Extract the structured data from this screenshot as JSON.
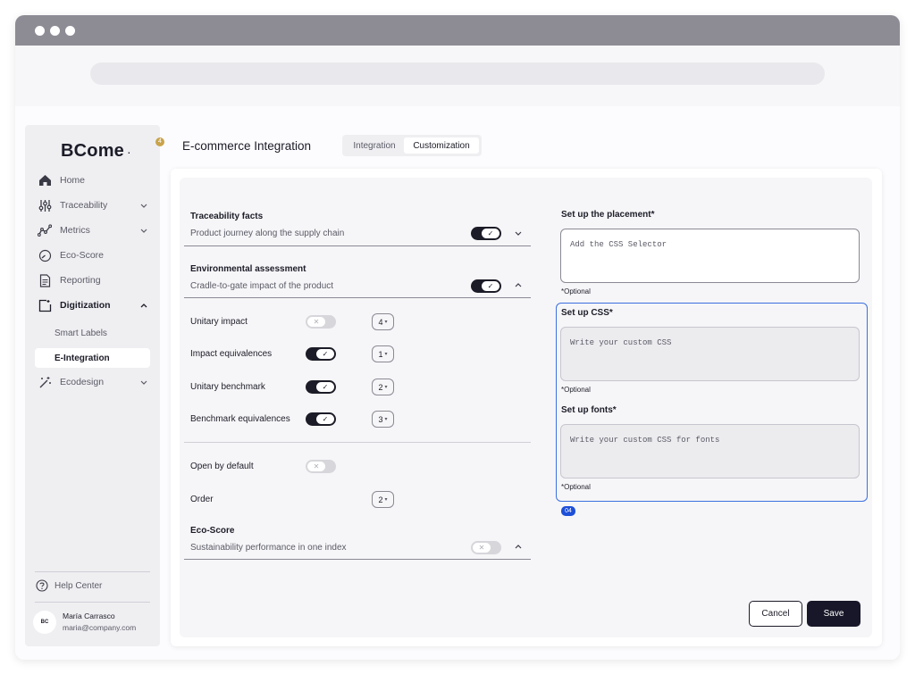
{
  "sidebar": {
    "logo": "BCome",
    "logo_mark": "·",
    "badge": "4",
    "items": [
      {
        "label": "Home",
        "icon": "home-icon"
      },
      {
        "label": "Traceability",
        "icon": "sliders-icon"
      },
      {
        "label": "Metrics",
        "icon": "chart-line-icon"
      },
      {
        "label": "Eco-Score",
        "icon": "gauge-icon"
      },
      {
        "label": "Reporting",
        "icon": "document-icon"
      },
      {
        "label": "Digitization",
        "icon": "digitization-icon"
      },
      {
        "label": "Ecodesign",
        "icon": "magic-wand-icon"
      }
    ],
    "subitems": [
      {
        "label": "Smart Labels"
      },
      {
        "label": "E-Integration"
      }
    ],
    "help": "Help Center",
    "user": {
      "initials": "BC",
      "name": "María Carrasco",
      "email": "maria@company.com"
    }
  },
  "header": {
    "title": "E-commerce Integration",
    "tabs": [
      {
        "label": "Integration"
      },
      {
        "label": "Customization"
      }
    ]
  },
  "left": {
    "traceability": {
      "title": "Traceability facts",
      "subtitle": "Product journey along the supply chain",
      "enabled": true
    },
    "environmental": {
      "title": "Environmental assessment",
      "subtitle": "Cradle-to-gate impact of the product",
      "enabled": true
    },
    "rows": [
      {
        "label": "Unitary impact",
        "enabled": false,
        "order": "4"
      },
      {
        "label": "Impact equivalences",
        "enabled": true,
        "order": "1"
      },
      {
        "label": "Unitary benchmark",
        "enabled": true,
        "order": "2"
      },
      {
        "label": "Benchmark equivalences",
        "enabled": true,
        "order": "3"
      }
    ],
    "open_by_default": {
      "label": "Open by default",
      "enabled": false
    },
    "order": {
      "label": "Order",
      "value": "2"
    },
    "ecoscore": {
      "title": "Eco-Score",
      "subtitle": "Sustainability performance in one index",
      "enabled": false
    }
  },
  "right": {
    "placement": {
      "label": "Set up the placement*",
      "placeholder": "Add the CSS Selector",
      "optional": "*Optional"
    },
    "css": {
      "label": "Set up CSS*",
      "placeholder": "Write your custom CSS",
      "optional": "*Optional"
    },
    "fonts": {
      "label": "Set up fonts*",
      "placeholder": "Write your custom CSS for fonts",
      "optional": "*Optional"
    },
    "step_badge": "04"
  },
  "actions": {
    "cancel": "Cancel",
    "save": "Save"
  },
  "colors": {
    "accent": "#1c1c28",
    "highlight": "#3b6fe0",
    "badge": "#c9a34a"
  }
}
